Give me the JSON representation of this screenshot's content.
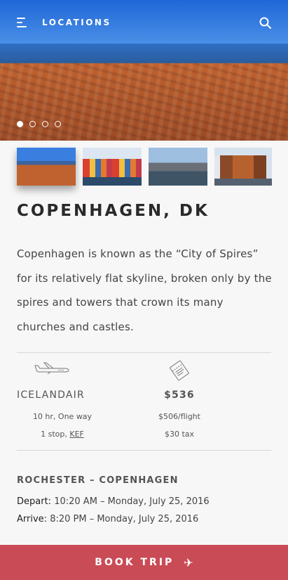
{
  "header": {
    "title": "LOCATIONS"
  },
  "carousel": {
    "slides": 4,
    "active_index": 0
  },
  "thumbnails": [
    "copenhagen-rooftops",
    "nyhavn-colorful-houses",
    "harbor-canal",
    "castle-on-water"
  ],
  "destination": {
    "title": "COPENHAGEN, DK",
    "description": "Copenhagen is known as the “City of Spires” for its relatively flat skyline, broken only by the spires and towers that crown its many churches and castles."
  },
  "flight": {
    "airline": "ICELANDAIR",
    "duration": "10 hr, One way",
    "stop_text": "1 stop,",
    "stop_code": "KEF",
    "icon": "airplane-icon"
  },
  "price": {
    "total": "$536",
    "per_flight": "$506/flight",
    "tax": "$30 tax",
    "icon": "ticket-icon"
  },
  "route": {
    "title": "ROCHESTER – COPENHAGEN",
    "depart_label": "Depart:",
    "depart_value": "10:20 AM – Monday, July 25, 2016",
    "arrive_label": "Arrive:",
    "arrive_value": "8:20 PM – Monday, July 25, 2016"
  },
  "cta": {
    "label": "BOOK TRIP",
    "icon": "plane-icon",
    "color": "#c94b56"
  }
}
